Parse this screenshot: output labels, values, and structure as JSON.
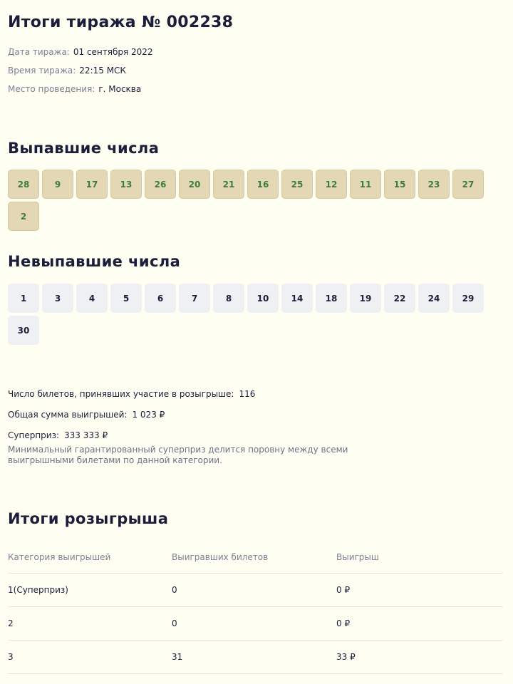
{
  "title": "Итоги тиража № 002238",
  "meta": [
    {
      "label": "Дата тиража:",
      "value": "01 сентября 2022"
    },
    {
      "label": "Время тиража:",
      "value": "22:15 МСК"
    },
    {
      "label": "Место проведения:",
      "value": "г. Москва"
    }
  ],
  "drawn": {
    "title": "Выпавшие числа",
    "numbers": [
      "28",
      "9",
      "17",
      "13",
      "26",
      "20",
      "21",
      "16",
      "25",
      "12",
      "11",
      "15",
      "23",
      "27",
      "2"
    ]
  },
  "not_drawn": {
    "title": "Невыпавшие числа",
    "numbers": [
      "1",
      "3",
      "4",
      "5",
      "6",
      "7",
      "8",
      "10",
      "14",
      "18",
      "19",
      "22",
      "24",
      "29",
      "30"
    ]
  },
  "stats": {
    "tickets_label": "Число билетов, принявших участие в розыгрыше:",
    "tickets_value": "116",
    "total_label": "Общая сумма выигрышей:",
    "total_value": "1 023 ₽",
    "superprize_label": "Суперприз:",
    "superprize_value": "333 333 ₽",
    "note": "Минимальный гарантированный суперприз делится поровну между всеми выигрышными билетами по данной категории."
  },
  "results": {
    "title": "Итоги розыгрыша",
    "columns": [
      "Категория выигрышей",
      "Выигравших билетов",
      "Выигрыш"
    ],
    "rows": [
      [
        "1(Суперприз)",
        "0",
        "0 ₽"
      ],
      [
        "2",
        "0",
        "0 ₽"
      ],
      [
        "3",
        "31",
        "33 ₽"
      ]
    ]
  }
}
